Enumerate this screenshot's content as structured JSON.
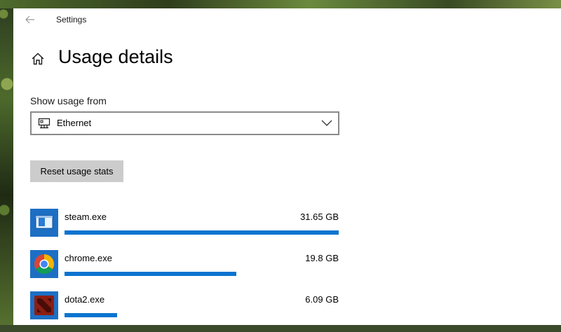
{
  "window": {
    "title": "Settings"
  },
  "page": {
    "title": "Usage details"
  },
  "usage_from": {
    "label": "Show usage from",
    "selected": "Ethernet"
  },
  "reset_button": {
    "label": "Reset usage stats"
  },
  "apps": [
    {
      "name": "steam.exe",
      "size": "31.65 GB",
      "fraction": 1.0,
      "icon": "steam-app-icon"
    },
    {
      "name": "chrome.exe",
      "size": "19.8 GB",
      "fraction": 0.626,
      "icon": "chrome-app-icon"
    },
    {
      "name": "dota2.exe",
      "size": "6.09 GB",
      "fraction": 0.193,
      "icon": "dota2-app-icon"
    }
  ],
  "colors": {
    "accent": "#0a74d0",
    "button_bg": "#cccccc",
    "window_bg": "#ffffff"
  }
}
